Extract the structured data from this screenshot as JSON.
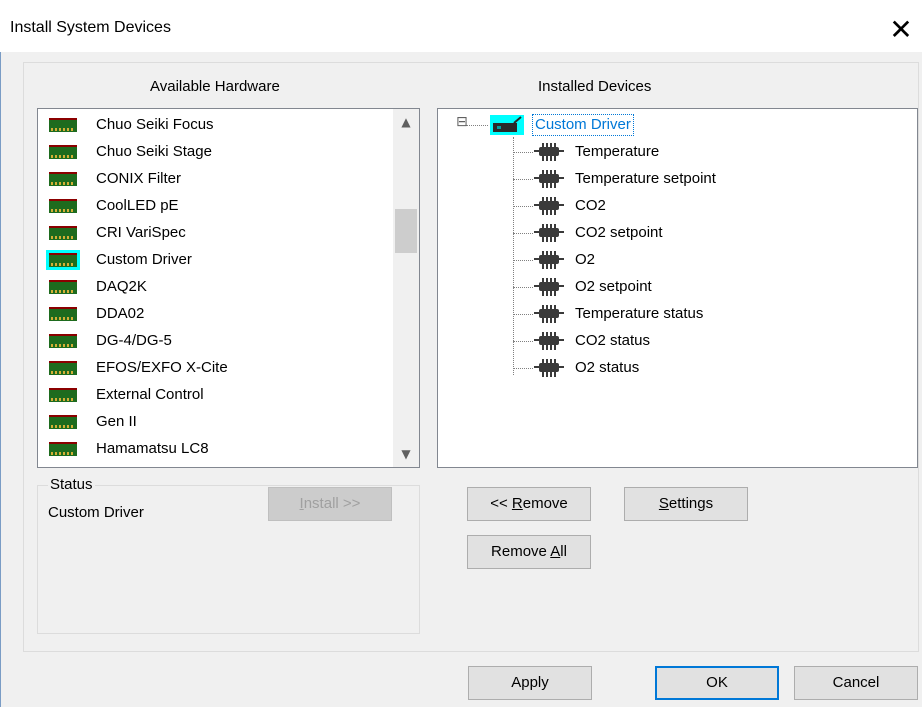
{
  "window": {
    "title": "Install System Devices",
    "close_glyph": "✕"
  },
  "available": {
    "label": "Available Hardware",
    "items": [
      {
        "label": "Chuo Seiki Focus",
        "selected": false
      },
      {
        "label": "Chuo Seiki Stage",
        "selected": false
      },
      {
        "label": "CONIX Filter",
        "selected": false
      },
      {
        "label": "CoolLED pE",
        "selected": false
      },
      {
        "label": "CRI VariSpec",
        "selected": false
      },
      {
        "label": "Custom Driver",
        "selected": true
      },
      {
        "label": "DAQ2K",
        "selected": false
      },
      {
        "label": "DDA02",
        "selected": false
      },
      {
        "label": "DG-4/DG-5",
        "selected": false
      },
      {
        "label": "EFOS/EXFO X-Cite",
        "selected": false
      },
      {
        "label": "External Control",
        "selected": false
      },
      {
        "label": "Gen II",
        "selected": false
      },
      {
        "label": "Hamamatsu LC8",
        "selected": false
      }
    ],
    "install_button": {
      "pre": "",
      "u": "I",
      "post": "nstall >>",
      "enabled": false
    }
  },
  "installed": {
    "label": "Installed Devices",
    "expander": "⊟",
    "root": {
      "label": "Custom Driver",
      "selected": true
    },
    "children": [
      "Temperature",
      "Temperature setpoint",
      "CO2",
      "CO2 setpoint",
      "O2",
      "O2 setpoint",
      "Temperature status",
      "CO2 status",
      "O2 status"
    ],
    "remove_button": {
      "pre": "<< ",
      "u": "R",
      "post": "emove"
    },
    "settings_button": {
      "pre": "",
      "u": "S",
      "post": "ettings"
    },
    "remove_all_button": {
      "pre": "Remove ",
      "u": "A",
      "post": "ll"
    }
  },
  "status": {
    "legend": "Status",
    "value": "Custom Driver"
  },
  "footer": {
    "apply": "Apply",
    "ok": "OK",
    "cancel": "Cancel"
  },
  "colors": {
    "selection": "#00ffff",
    "tree_selection_text": "#0078d7"
  }
}
